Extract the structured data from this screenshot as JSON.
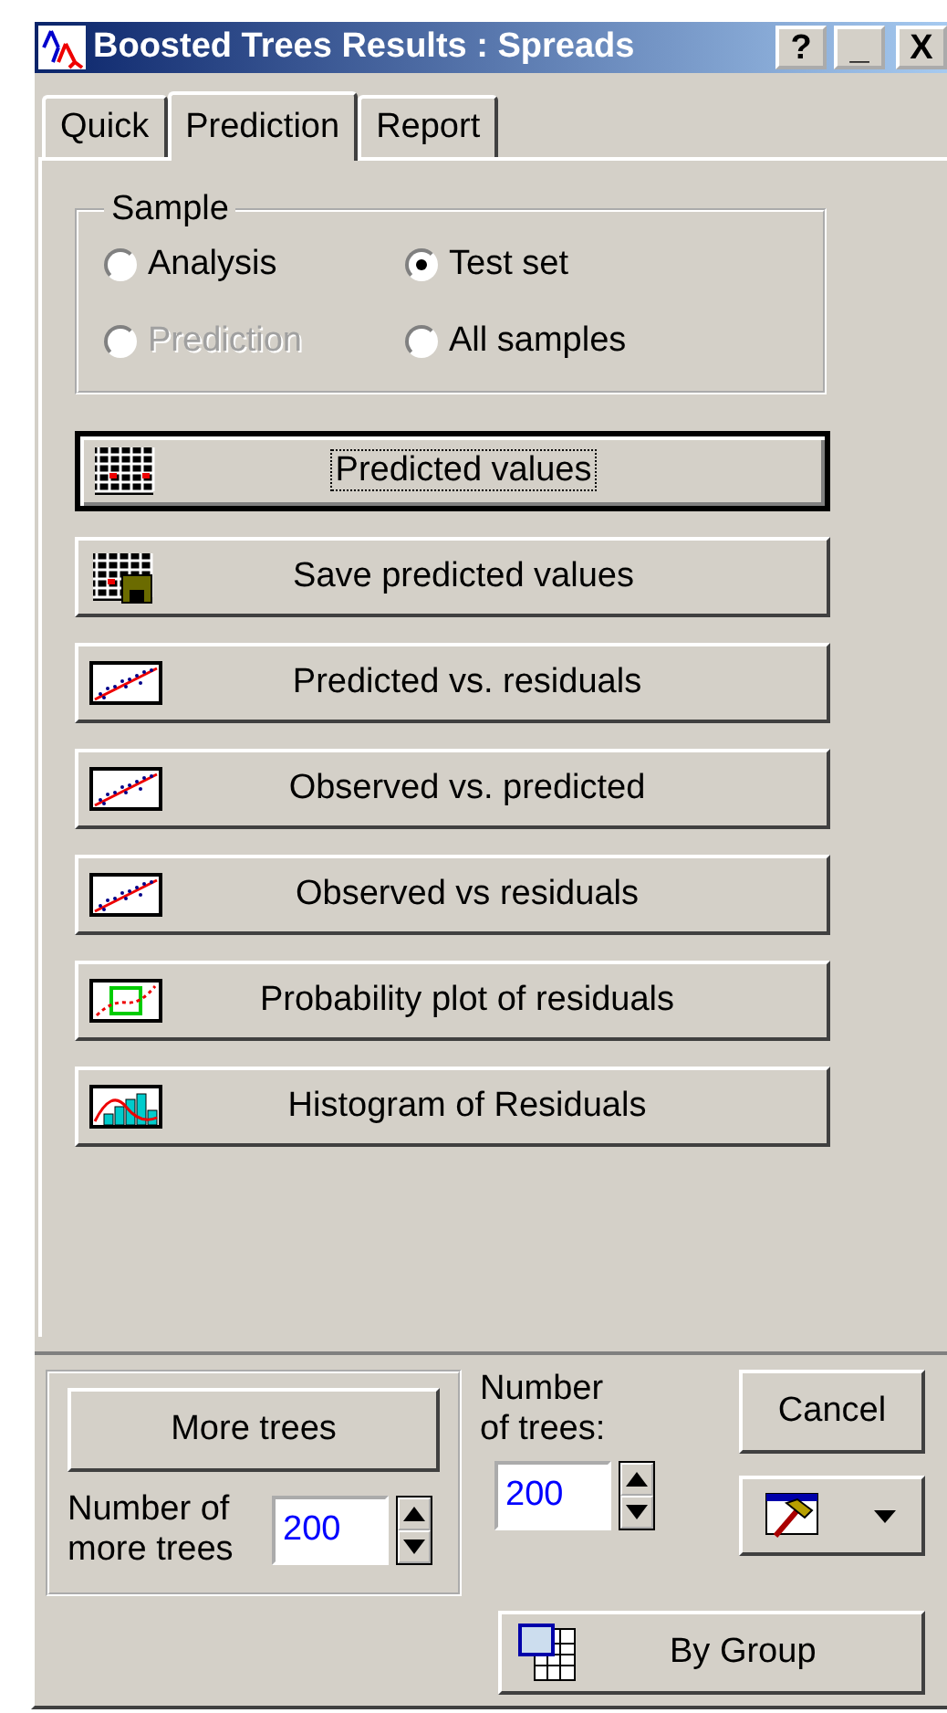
{
  "window": {
    "title": "Boosted Trees Results : Spreads",
    "controls": [
      {
        "kind": "help",
        "label": "?"
      },
      {
        "kind": "minimize",
        "label": "_"
      },
      {
        "kind": "close",
        "label": "X"
      }
    ]
  },
  "tabs": [
    {
      "label": "Quick",
      "selected": false
    },
    {
      "label": "Prediction",
      "selected": true
    },
    {
      "label": "Report",
      "selected": false
    }
  ],
  "sample": {
    "title": "Sample",
    "options": [
      {
        "label": "Analysis",
        "selected": false,
        "disabled": false
      },
      {
        "label": "Test set",
        "selected": true,
        "disabled": false
      },
      {
        "label": "Prediction",
        "selected": false,
        "disabled": true
      },
      {
        "label": "All samples",
        "selected": false,
        "disabled": false
      }
    ]
  },
  "actions": [
    {
      "label": "Predicted values",
      "kind": "grid",
      "focused": true
    },
    {
      "label": "Save predicted values",
      "kind": "grid-save",
      "focused": false
    },
    {
      "label": "Predicted vs. residuals",
      "kind": "scatter",
      "focused": false
    },
    {
      "label": "Observed vs. predicted",
      "kind": "scatter",
      "focused": false
    },
    {
      "label": "Observed vs residuals",
      "kind": "scatter",
      "focused": false
    },
    {
      "label": "Probability plot of residuals",
      "kind": "probability",
      "focused": false
    },
    {
      "label": "Histogram of Residuals",
      "kind": "histogram",
      "focused": false
    }
  ],
  "more_trees": {
    "button": "More trees",
    "label": "Number of more trees",
    "value": "200"
  },
  "trees": {
    "label": "Number of trees:",
    "value": "200"
  },
  "cancel": "Cancel",
  "by_group": "By Group"
}
